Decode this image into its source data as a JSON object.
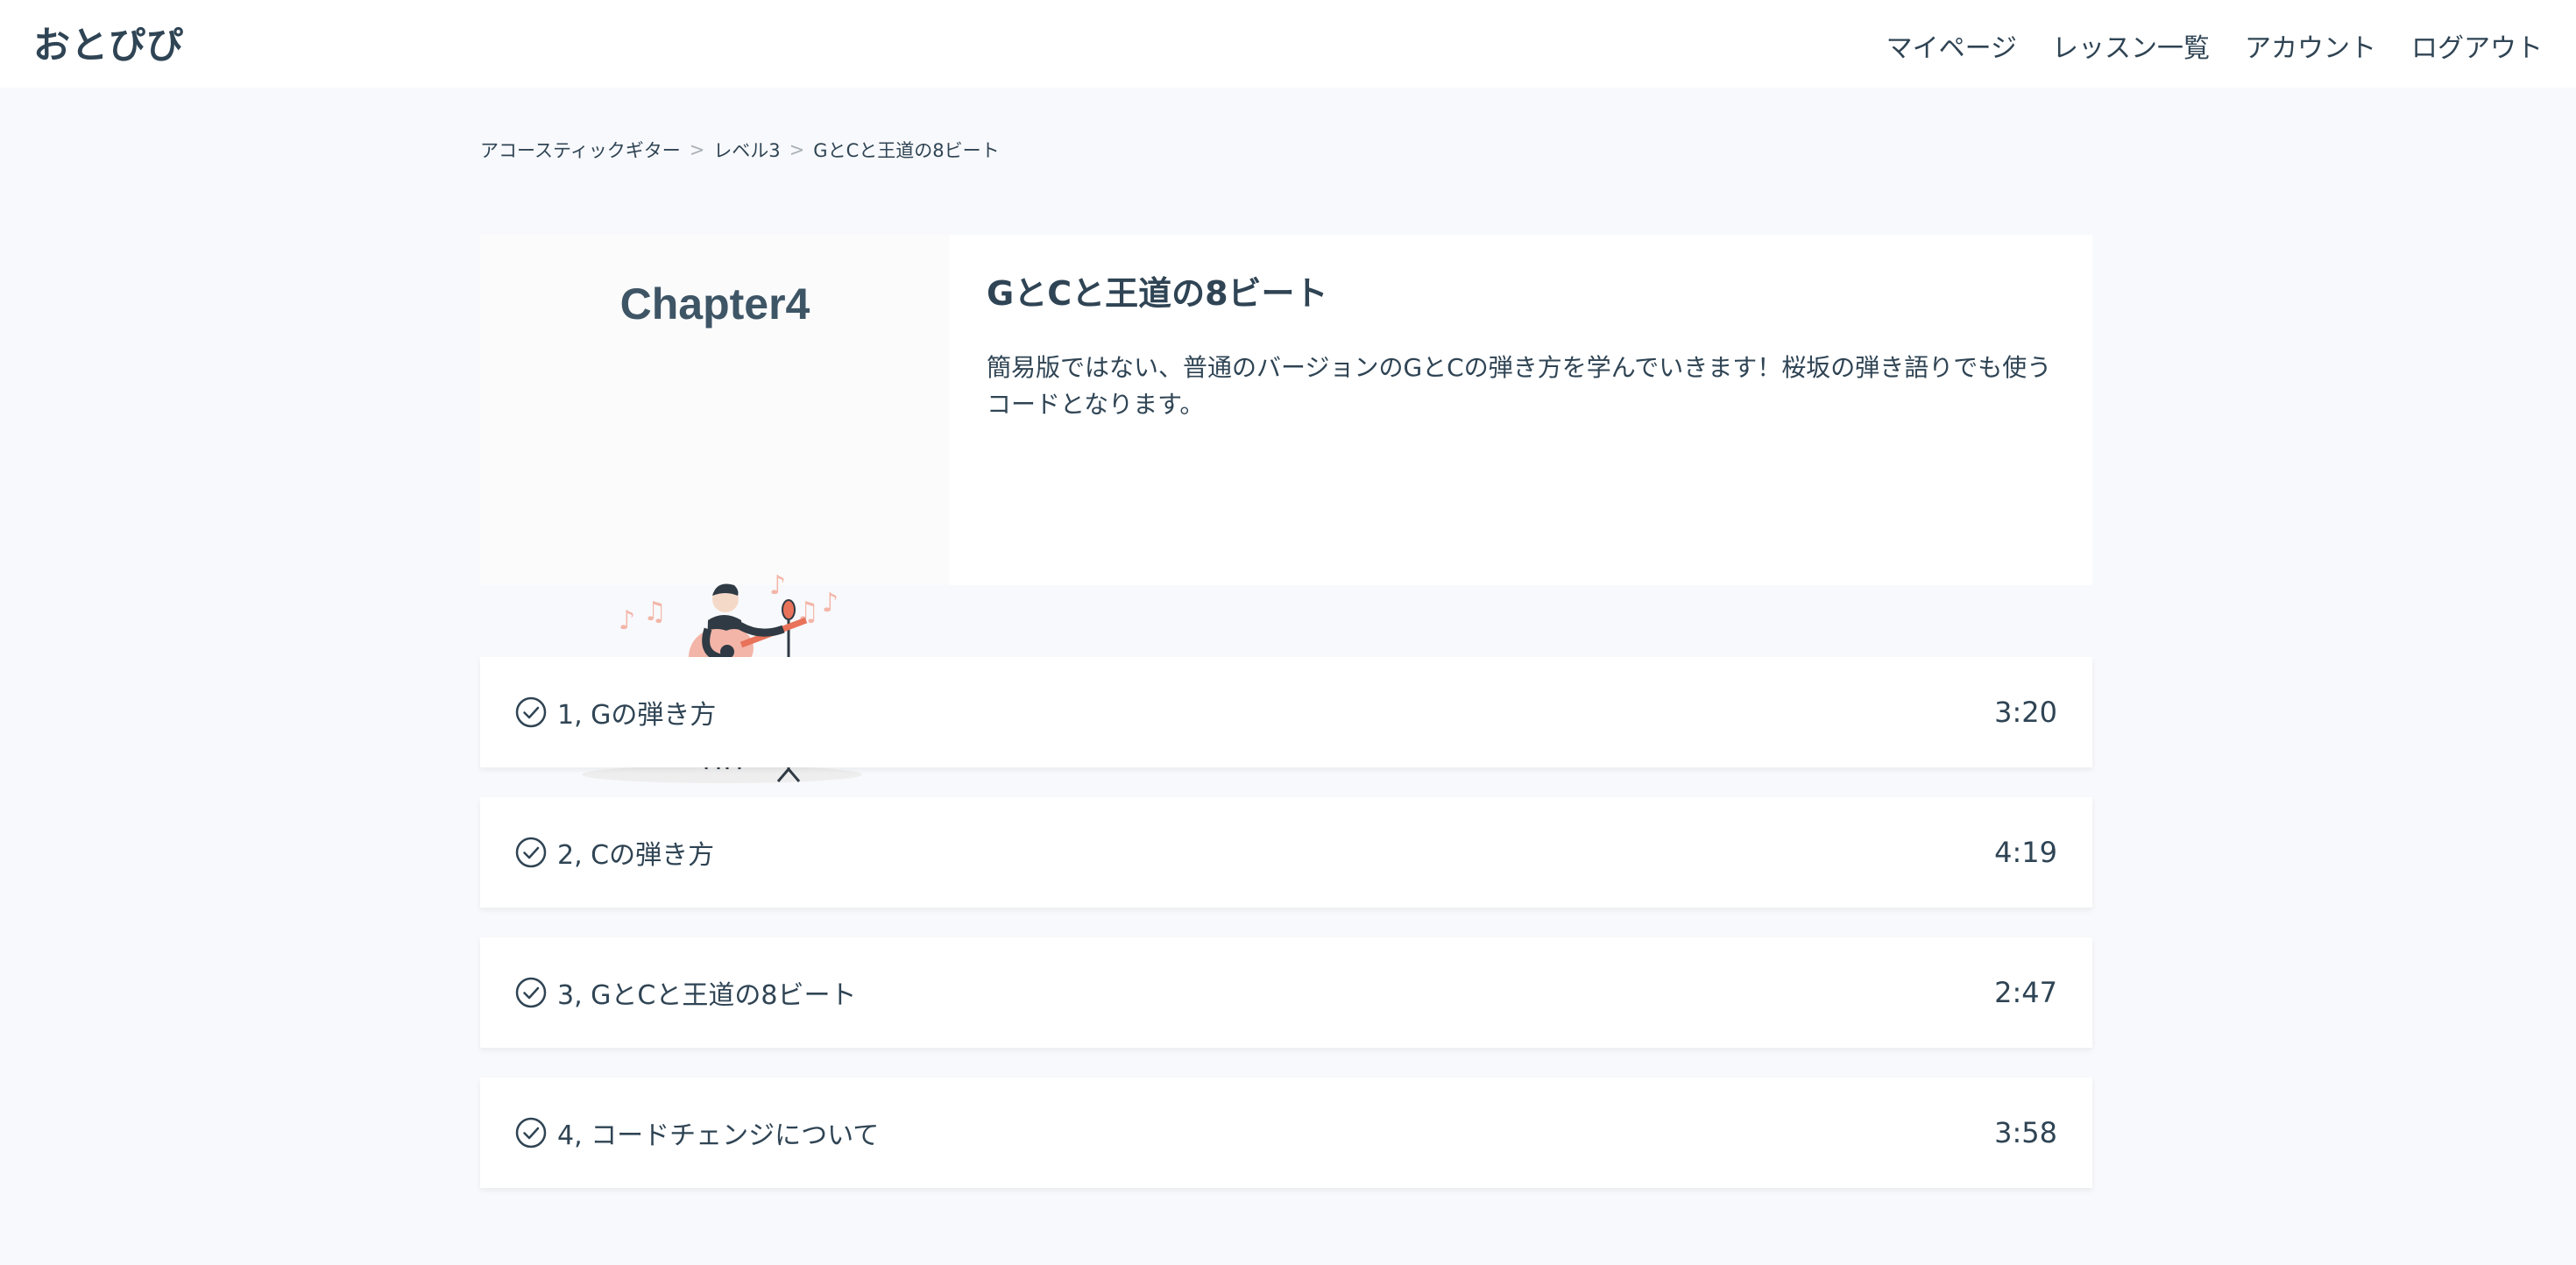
{
  "header": {
    "logo": "おとぴぴ",
    "nav": [
      "マイページ",
      "レッスン一覧",
      "アカウント",
      "ログアウト"
    ]
  },
  "breadcrumb": [
    "アコースティックギター",
    "レベル3",
    "GとCと王道の8ビート"
  ],
  "breadcrumb_separator": ">",
  "chapter": {
    "thumb_title": "Chapter4",
    "title": "GとCと王道の8ビート",
    "description": "簡易版ではない、普通のバージョンのGとCの弾き方を学んでいきます！桜坂の弾き語りでも使うコードとなります。"
  },
  "lessons": [
    {
      "label": "1, Gの弾き方",
      "duration": "3:20"
    },
    {
      "label": "2, Cの弾き方",
      "duration": "4:19"
    },
    {
      "label": "3, GとCと王道の8ビート",
      "duration": "2:47"
    },
    {
      "label": "4, コードチェンジについて",
      "duration": "3:58"
    }
  ],
  "colors": {
    "text": "#2f4454",
    "background": "#f8f9fc",
    "card": "#ffffff",
    "accent": "#e8735a"
  }
}
